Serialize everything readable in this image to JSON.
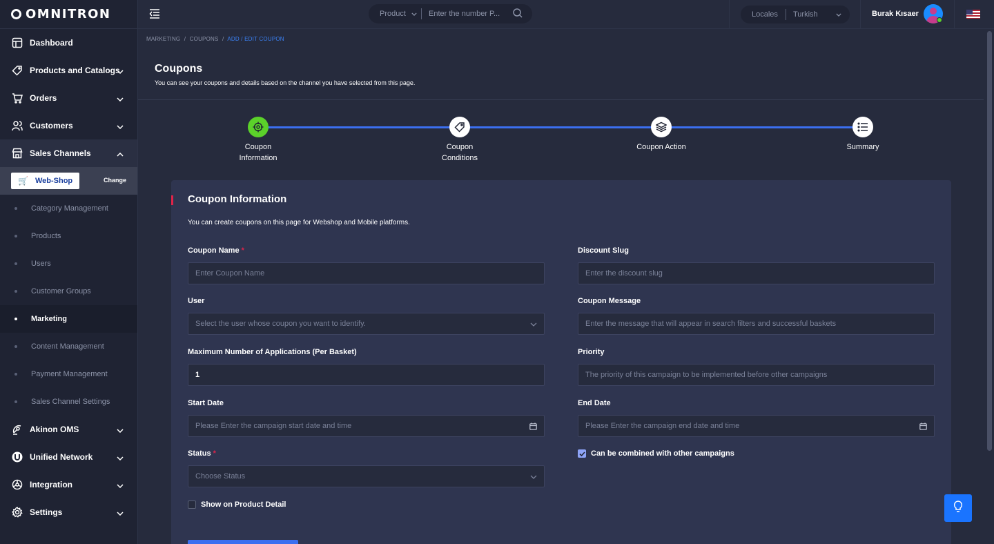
{
  "app": {
    "logo_text": "OMNITRON"
  },
  "sidebar": {
    "items": [
      {
        "label": "Dashboard",
        "icon": "layout-icon"
      },
      {
        "label": "Products and Catalogs",
        "icon": "tag-icon"
      },
      {
        "label": "Orders",
        "icon": "cart-icon"
      },
      {
        "label": "Customers",
        "icon": "users-icon"
      },
      {
        "label": "Sales Channels",
        "icon": "store-icon"
      }
    ],
    "channel": {
      "name": "Web-Shop",
      "change_label": "Change"
    },
    "sub_items": [
      "Category Management",
      "Products",
      "Users",
      "Customer Groups",
      "Marketing",
      "Content Management",
      "Payment Management",
      "Sales Channel Settings"
    ],
    "active_sub": "Marketing",
    "bottom_items": [
      {
        "label": "Akinon OMS",
        "icon": "satellite-icon"
      },
      {
        "label": "Unified Network",
        "icon": "network-icon"
      },
      {
        "label": "Integration",
        "icon": "integration-icon"
      },
      {
        "label": "Settings",
        "icon": "gear-icon"
      }
    ]
  },
  "topbar": {
    "search_select": "Product",
    "search_placeholder": "Enter the number P...",
    "locales_label": "Locales",
    "locales_value": "Turkish",
    "user_name": "Burak Kısaer"
  },
  "breadcrumb": {
    "items": [
      "MARKETING",
      "COUPONS"
    ],
    "current": "ADD / EDIT COUPON",
    "separator": "/"
  },
  "page": {
    "title": "Coupons",
    "description": "You can see your coupons and details based on the channel you have selected from this page."
  },
  "stepper": {
    "steps": [
      {
        "label_line1": "Coupon",
        "label_line2": "Information",
        "icon": "target-icon",
        "active": true
      },
      {
        "label_line1": "Coupon",
        "label_line2": "Conditions",
        "icon": "tag-icon",
        "active": false
      },
      {
        "label_line1": "Coupon Action",
        "label_line2": "",
        "icon": "layers-icon",
        "active": false
      },
      {
        "label_line1": "Summary",
        "label_line2": "",
        "icon": "list-icon",
        "active": false
      }
    ]
  },
  "form": {
    "title": "Coupon Information",
    "description": "You can create coupons on this page for Webshop and Mobile platforms.",
    "required_mark": "*",
    "coupon_name": {
      "label": "Coupon Name",
      "placeholder": "Enter Coupon Name"
    },
    "discount_slug": {
      "label": "Discount Slug",
      "placeholder": "Enter the discount slug"
    },
    "user": {
      "label": "User",
      "placeholder": "Select the user whose coupon you want to identify."
    },
    "coupon_message": {
      "label": "Coupon Message",
      "placeholder": "Enter the message that will appear in search filters and successful baskets"
    },
    "max_applications": {
      "label": "Maximum Number of Applications (Per Basket)",
      "value": "1"
    },
    "priority": {
      "label": "Priority",
      "placeholder": "The priority of this campaign to be implemented before other campaigns"
    },
    "start_date": {
      "label": "Start Date",
      "placeholder": "Please Enter the campaign start date and time"
    },
    "end_date": {
      "label": "End Date",
      "placeholder": "Please Enter the campaign end date and time"
    },
    "status": {
      "label": "Status",
      "placeholder": "Choose Status"
    },
    "combine": {
      "label": "Can be combined with other campaigns",
      "checked": true
    },
    "show_on_product_detail": {
      "label": "Show on Product Detail",
      "checked": false
    }
  },
  "colors": {
    "accent": "#3b6ff0",
    "active_step": "#5bd12a",
    "required": "#e0244a",
    "sidebar_bg": "#1f2333",
    "page_bg": "#262b3d",
    "card_bg": "#2f3550"
  }
}
